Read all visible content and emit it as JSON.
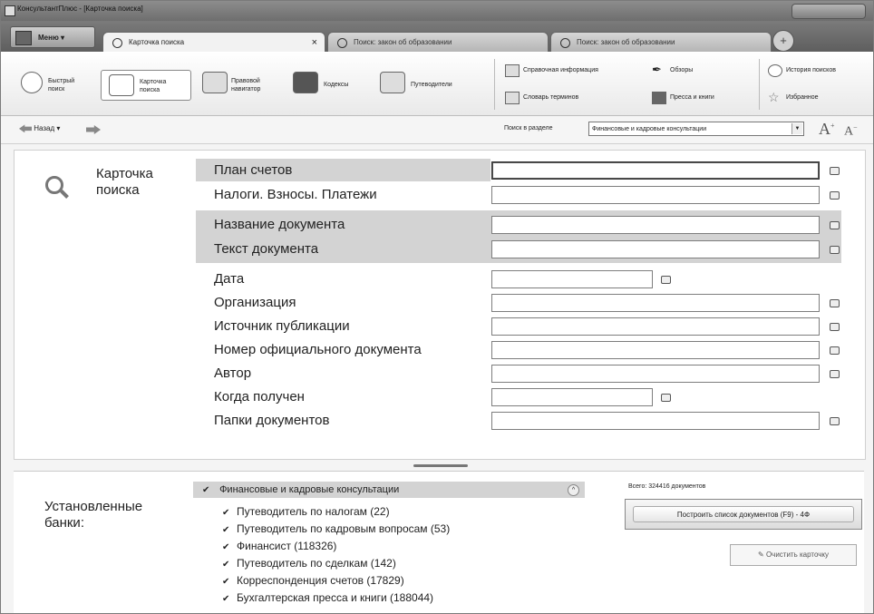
{
  "window": {
    "title": "КонсультантПлюс - [Карточка поиска]"
  },
  "menu": {
    "label": "Меню"
  },
  "tabs": [
    {
      "label": "Карточка поиска",
      "active": true
    },
    {
      "label": "Поиск: закон об образовании",
      "active": false
    },
    {
      "label": "Поиск: закон об образовании",
      "active": false
    }
  ],
  "ribbon": {
    "quick_search": "Быстрый поиск",
    "search_card": "Карточка поиска",
    "legal_navigator": "Правовой навигатор",
    "codes": "Кодексы",
    "guides": "Путеводители",
    "reference_info": "Справочная информация",
    "reviews": "Обзоры",
    "glossary": "Словарь терминов",
    "press_books": "Пресса и книги",
    "search_history": "История поисков",
    "favorites": "Избранное"
  },
  "nav": {
    "back_label": "Назад",
    "section_label": "Поиск в разделе",
    "section_value": "Финансовые и кадровые консультации",
    "font_larger": "A",
    "font_smaller": "A"
  },
  "card": {
    "title": "Карточка поиска",
    "fields": [
      {
        "label": "План счетов",
        "value": ""
      },
      {
        "label": "Налоги. Взносы. Платежи",
        "value": ""
      },
      {
        "label": "Название документа",
        "value": ""
      },
      {
        "label": "Текст документа",
        "value": ""
      },
      {
        "label": "Дата",
        "value": ""
      },
      {
        "label": "Организация",
        "value": ""
      },
      {
        "label": "Источник публикации",
        "value": ""
      },
      {
        "label": "Номер официального документа",
        "value": ""
      },
      {
        "label": "Автор",
        "value": ""
      },
      {
        "label": "Когда получен",
        "value": ""
      },
      {
        "label": "Папки документов",
        "value": ""
      }
    ]
  },
  "banks": {
    "label": "Установленные банки:",
    "header": "Финансовые и кадровые консультации",
    "items": [
      "Путеводитель по налогам (22)",
      "Путеводитель по кадровым вопросам (53)",
      "Финансист (118326)",
      "Путеводитель по сделкам (142)",
      "Корреспонденция счетов (17829)",
      "Бухгалтерская пресса и книги (188044)"
    ],
    "total": "Всего: 324416 документов",
    "build_button": "Построить список документов (F9) - 4Ф",
    "clear_button": "Очистить карточку"
  }
}
